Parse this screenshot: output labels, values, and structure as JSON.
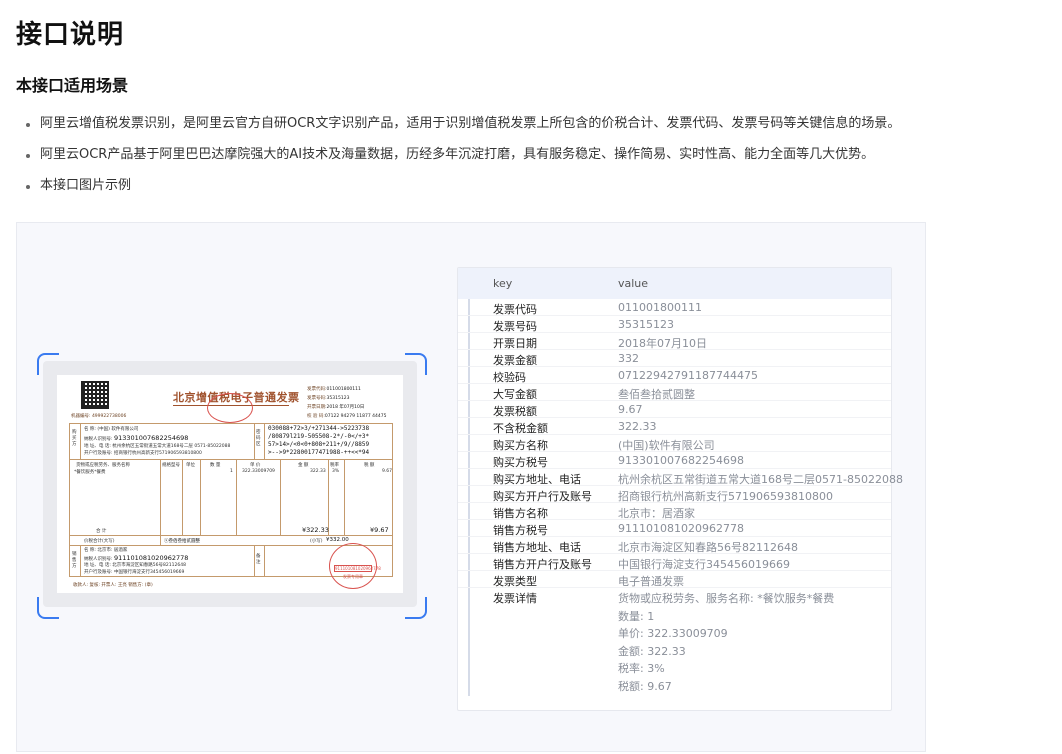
{
  "page_title": "接口说明",
  "section_title": "本接口适用场景",
  "bullets": [
    "阿里云增值税发票识别，是阿里云官方自研OCR文字识别产品，适用于识别增值税发票上所包含的价税合计、发票代码、发票号码等关键信息的场景。",
    "阿里云OCR产品基于阿里巴巴达摩院强大的AI技术及海量数据，历经多年沉淀打磨，具有服务稳定、操作简易、实时性高、能力全面等几大优势。",
    "本接口图片示例"
  ],
  "invoice_image": {
    "title": "北京增值税电子普通发票",
    "meta": {
      "code_label": "发票代码:",
      "code": "011001800111",
      "number_label": "发票号码:",
      "number": "35315123",
      "date_label": "开票日期:",
      "date": "2018 年07月10日",
      "check_label": "校 验 码:",
      "check": "07122 94279 11877 44475"
    },
    "machine_code": "机器编号: 499922738006",
    "buyer_side": "购买方",
    "buyer_name": "名    称: (中国) 软件有限公司",
    "buyer_tax_id": "913301007682254698",
    "buyer_tax_label": "纳税人识别号:",
    "buyer_address": "地 址、电 话: 杭州余杭区五常街道五常大道168号二层 0571-85022088",
    "buyer_bank": "开户行及账号: 招商银行杭州高新支行571906593810800",
    "cipher_label": "密码区",
    "cipher": [
      "030088+72>3/+271344->5223738",
      "/80879l219-505508-2*/-0</+3*",
      "57>14>/<0<0+808+211+/9//8859",
      ">-->9*22800177471988-++<<*94"
    ],
    "items_header": [
      "货物或应税劳务、服务名称",
      "规格型号",
      "单位",
      "数 量",
      "单 价",
      "金 额",
      "税率",
      "税 额"
    ],
    "item_row": [
      "*餐饮服务*餐费",
      "",
      "",
      "1",
      "322.33009709",
      "322.33",
      "3%",
      "9.67"
    ],
    "subtotal_label": "合         计",
    "subtotal_amount": "¥322.33",
    "subtotal_tax": "¥9.67",
    "total_label": "价税合计(大写)",
    "total_words": "ⓧ叁佰叁拾贰圆整",
    "total_small_label": "(小写)",
    "total_small": "¥332.00",
    "seller_side": "销售方",
    "seller_name": "名    称: 北京市: 居酒家",
    "seller_tax_label": "纳税人识别号:",
    "seller_tax_id": "911101081020962778",
    "seller_address": "地 址、电 话: 北京市海淀区知春路56号82112648",
    "seller_bank": "开户行及账号: 中国银行海淀支行345456019669",
    "remark_label": "备注",
    "seal_text": "发票专用章",
    "seal_id": "911101081020962778",
    "footer": "收款人:            复核:            开票人: 王亮            销售方: (章)"
  },
  "kv_table": {
    "header_key": "key",
    "header_value": "value",
    "rows": [
      {
        "key": "发票代码",
        "value": "011001800111"
      },
      {
        "key": "发票号码",
        "value": "35315123"
      },
      {
        "key": "开票日期",
        "value": "2018年07月10日"
      },
      {
        "key": "发票金额",
        "value": "332"
      },
      {
        "key": "校验码",
        "value": "07122942791187744475"
      },
      {
        "key": "大写金额",
        "value": "叁佰叁拾贰圆整"
      },
      {
        "key": "发票税额",
        "value": "9.67"
      },
      {
        "key": "不含税金额",
        "value": "322.33"
      },
      {
        "key": "购买方名称",
        "value": "(中国)软件有限公司"
      },
      {
        "key": "购买方税号",
        "value": "913301007682254698"
      },
      {
        "key": "购买方地址、电话",
        "value": "杭州余杭区五常街道五常大道168号二层0571-85022088"
      },
      {
        "key": "购买方开户行及账号",
        "value": "招商银行杭州高新支行571906593810800"
      },
      {
        "key": "销售方名称",
        "value": "北京市：居酒家"
      },
      {
        "key": "销售方税号",
        "value": "911101081020962778"
      },
      {
        "key": "销售方地址、电话",
        "value": "北京市海淀区知春路56号82112648"
      },
      {
        "key": "销售方开户行及账号",
        "value": "中国银行海淀支行345456019669"
      },
      {
        "key": "发票类型",
        "value": "电子普通发票"
      }
    ],
    "detail": {
      "key": "发票详情",
      "lines": [
        "货物或应税劳务、服务名称: *餐饮服务*餐费",
        "数量: 1",
        "单价: 322.33009709",
        "金额: 322.33",
        "税率: 3%",
        "税额: 9.67"
      ]
    }
  }
}
